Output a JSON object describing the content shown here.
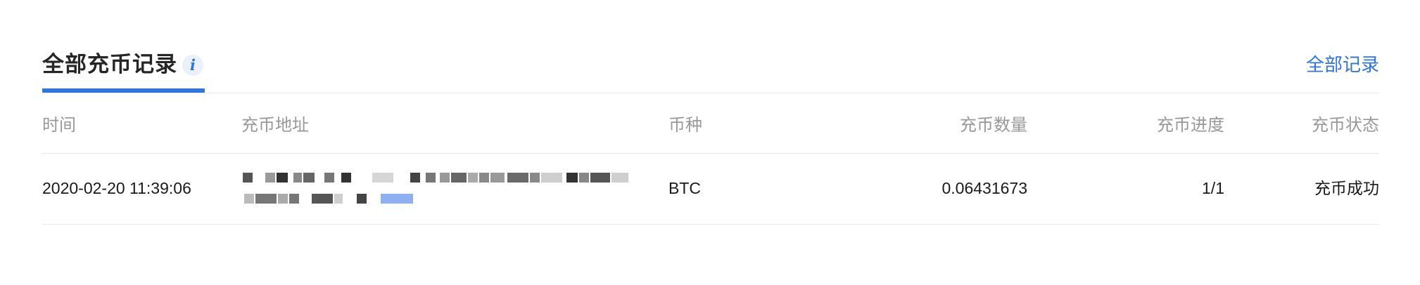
{
  "header": {
    "title": "全部充币记录",
    "info_icon": "i",
    "all_records_link": "全部记录"
  },
  "table": {
    "columns": [
      "时间",
      "充币地址",
      "币种",
      "充币数量",
      "充币进度",
      "充币状态"
    ],
    "rows": [
      {
        "time": "2020-02-20 11:39:06",
        "address": "",
        "coin": "BTC",
        "amount": "0.06431673",
        "progress": "1/1",
        "status": "充币成功"
      }
    ]
  },
  "colors": {
    "accent": "#2f74e0",
    "header_text": "#999999",
    "body_text": "#1a1a1a",
    "divider": "#e8e8e8"
  }
}
